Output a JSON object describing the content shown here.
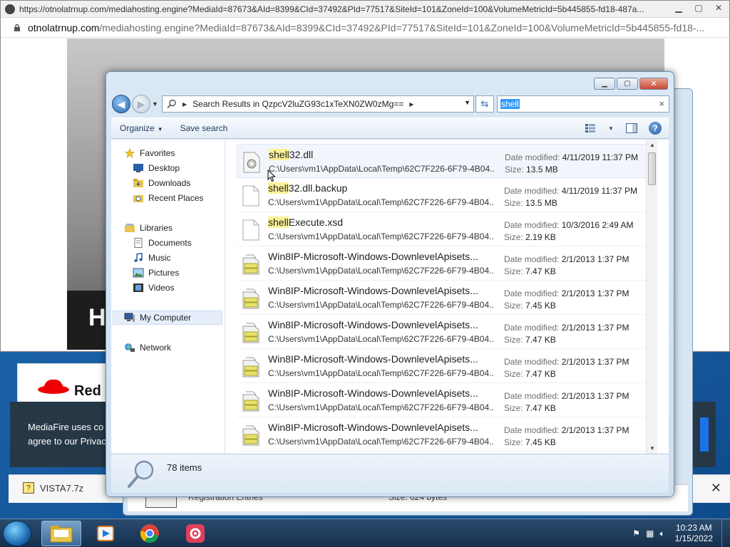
{
  "popup": {
    "titlebar_url": "https://otnolatrnup.com/mediahosting.engine?MediaId=87673&AId=8399&CId=37492&PId=77517&SiteId=101&ZoneId=100&VolumeMetricId=5b445855-fd18-487a...",
    "addr_domain": "otnolatrnup.com",
    "addr_rest": "/mediahosting.engine?MediaId=87673&AId=8399&CId=37492&PId=77517&SiteId=101&ZoneId=100&VolumeMetricId=5b445855-fd18-...",
    "big_letter": "H"
  },
  "lower_page": {
    "brand": "Red",
    "banner_line1": "MediaFire uses co",
    "banner_line2": "agree to our Privac",
    "download_file": "VISTA7.7z",
    "close_glyph": "✕"
  },
  "explorer_back": {
    "registration_text": "Registration Entries",
    "size_text": "Size: 624 bytes"
  },
  "explorer": {
    "address_path": "Search Results in QzpcV2luZG93c1xTeXN0ZW0zMg==",
    "search_query": "shell",
    "toolbar": {
      "organize": "Organize",
      "save_search": "Save search"
    },
    "nav": {
      "favorites": "Favorites",
      "desktop": "Desktop",
      "downloads": "Downloads",
      "recent_places": "Recent Places",
      "libraries": "Libraries",
      "documents": "Documents",
      "music": "Music",
      "pictures": "Pictures",
      "videos": "Videos",
      "my_computer": "My Computer",
      "network": "Network"
    },
    "labels": {
      "date_modified": "Date modified:",
      "size": "Size:"
    },
    "files": [
      {
        "hl": "shell",
        "rest": "32.dll",
        "path": "C:\\Users\\vm1\\AppData\\Local\\Temp\\62C7F226-6F79-4B04...",
        "date": "4/11/2019 11:37 PM",
        "size": "13.5 MB"
      },
      {
        "hl": "shell",
        "rest": "32.dll.backup",
        "path": "C:\\Users\\vm1\\AppData\\Local\\Temp\\62C7F226-6F79-4B04...",
        "date": "4/11/2019 11:37 PM",
        "size": "13.5 MB"
      },
      {
        "hl": "shell",
        "rest": "Execute.xsd",
        "path": "C:\\Users\\vm1\\AppData\\Local\\Temp\\62C7F226-6F79-4B04...",
        "date": "10/3/2016 2:49 AM",
        "size": "2.19 KB"
      },
      {
        "hl": "",
        "rest": "Win8IP-Microsoft-Windows-DownlevelApisets...",
        "path": "C:\\Users\\vm1\\AppData\\Local\\Temp\\62C7F226-6F79-4B04...",
        "date": "2/1/2013 1:37 PM",
        "size": "7.47 KB"
      },
      {
        "hl": "",
        "rest": "Win8IP-Microsoft-Windows-DownlevelApisets...",
        "path": "C:\\Users\\vm1\\AppData\\Local\\Temp\\62C7F226-6F79-4B04...",
        "date": "2/1/2013 1:37 PM",
        "size": "7.45 KB"
      },
      {
        "hl": "",
        "rest": "Win8IP-Microsoft-Windows-DownlevelApisets...",
        "path": "C:\\Users\\vm1\\AppData\\Local\\Temp\\62C7F226-6F79-4B04...",
        "date": "2/1/2013 1:37 PM",
        "size": "7.47 KB"
      },
      {
        "hl": "",
        "rest": "Win8IP-Microsoft-Windows-DownlevelApisets...",
        "path": "C:\\Users\\vm1\\AppData\\Local\\Temp\\62C7F226-6F79-4B04...",
        "date": "2/1/2013 1:37 PM",
        "size": "7.47 KB"
      },
      {
        "hl": "",
        "rest": "Win8IP-Microsoft-Windows-DownlevelApisets...",
        "path": "C:\\Users\\vm1\\AppData\\Local\\Temp\\62C7F226-6F79-4B04...",
        "date": "2/1/2013 1:37 PM",
        "size": "7.47 KB"
      },
      {
        "hl": "",
        "rest": "Win8IP-Microsoft-Windows-DownlevelApisets...",
        "path": "C:\\Users\\vm1\\AppData\\Local\\Temp\\62C7F226-6F79-4B04...",
        "date": "2/1/2013 1:37 PM",
        "size": "7.45 KB"
      }
    ],
    "item_count": "78 items"
  },
  "taskbar": {
    "time": "10:23 AM",
    "date": "1/15/2022"
  }
}
